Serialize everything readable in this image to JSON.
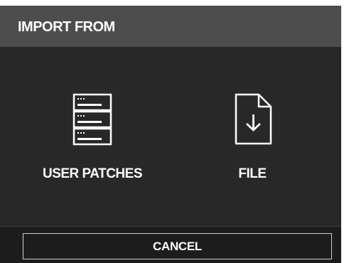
{
  "dialog": {
    "title": "IMPORT FROM",
    "options": [
      {
        "label": "USER PATCHES",
        "icon": "server-stack-icon"
      },
      {
        "label": "FILE",
        "icon": "file-download-icon"
      }
    ],
    "cancel_label": "CANCEL"
  },
  "colors": {
    "header_bg": "#4d4d4d",
    "body_bg": "#282828",
    "footer_bg": "#1c1c1c",
    "text": "#ffffff",
    "button_border": "#cfcfcf"
  }
}
